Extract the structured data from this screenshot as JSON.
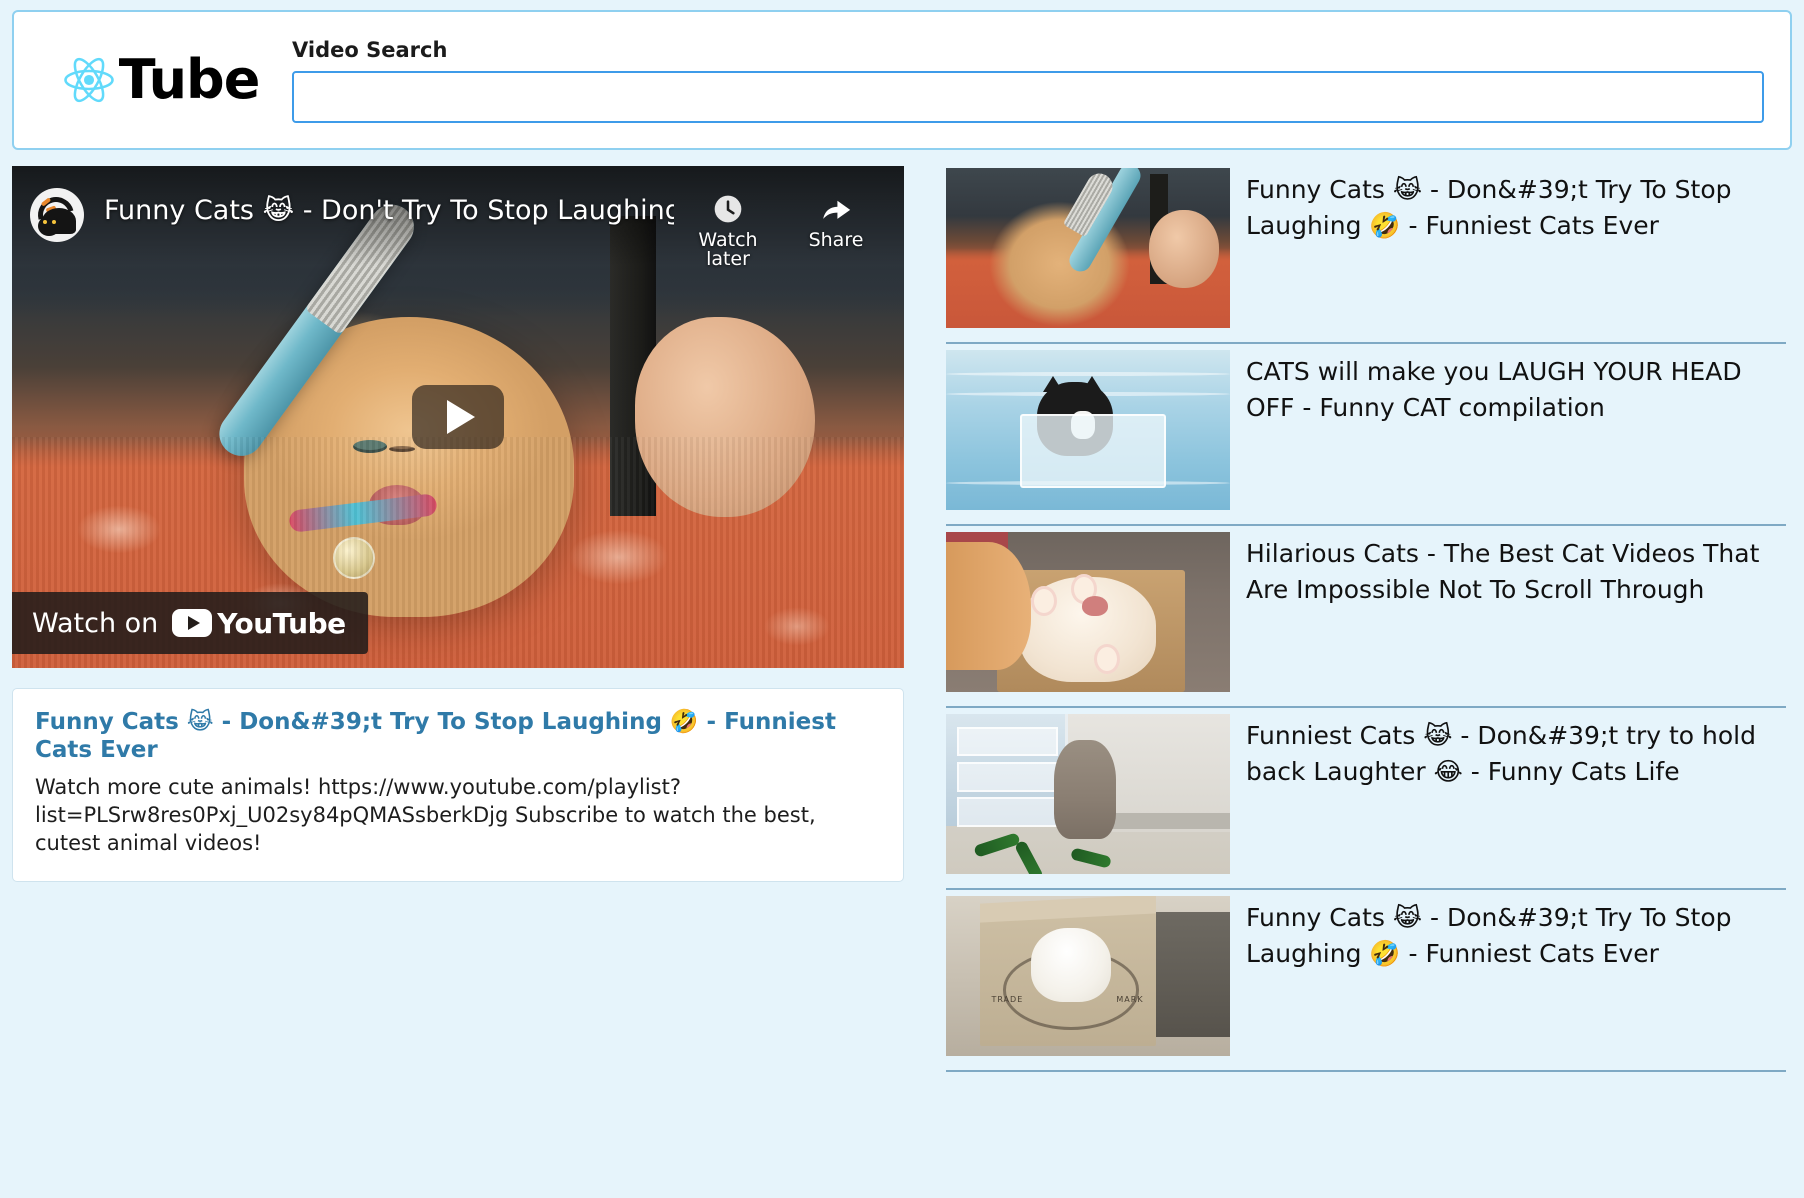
{
  "header": {
    "brand_name": "Tube",
    "logo_icon": "react-atom-icon",
    "logo_color": "#61dafb",
    "search_label": "Video Search",
    "search_value": "",
    "search_placeholder": ""
  },
  "player": {
    "overlay_title": "Funny Cats 😹 - Don't Try To Stop Laughing 🤣 - Fu…",
    "channel_avatar_icon": "black-cat-avatar-icon",
    "play_button_icon": "play-icon",
    "actions": [
      {
        "label": "Watch later",
        "icon": "clock-icon"
      },
      {
        "label": "Share",
        "icon": "share-arrow-icon"
      }
    ],
    "watch_on_text": "Watch on",
    "watch_on_brand": "YouTube",
    "watch_on_icon": "youtube-play-icon"
  },
  "description": {
    "title": "Funny Cats 😹 - Don&#39;t Try To Stop Laughing 🤣 - Funniest Cats Ever",
    "title_color": "#2f7aa8",
    "body": "Watch more cute animals! https://www.youtube.com/playlist?list=PLSrw8res0Pxj_U02sy84pQMASsberkDjg Subscribe to watch the best, cutest animal videos!"
  },
  "sidebar": {
    "items": [
      {
        "title": "Funny Cats 😹 - Don&#39;t Try To Stop Laughing 🤣 - Funniest Cats Ever",
        "thumbnail": "orange-cat-being-brushed"
      },
      {
        "title": "CATS will make you LAUGH YOUR HEAD OFF - Funny CAT compilation",
        "thumbnail": "tuxedo-cat-in-floating-box-pool"
      },
      {
        "title": "Hilarious Cats - The Best Cat Videos That Are Impossible Not To Scroll Through",
        "thumbnail": "white-orange-cat-lying-in-box"
      },
      {
        "title": "Funniest Cats 😹 - Don&#39;t try to hold back Laughter 😂 - Funny Cats Life",
        "thumbnail": "tabby-cat-with-cucumbers-by-fridge"
      },
      {
        "title": "Funny Cats 😹 - Don&#39;t Try To Stop Laughing 🤣 - Funniest Cats Ever",
        "thumbnail": "white-cat-head-through-cardboard-box"
      }
    ]
  },
  "theme": {
    "page_background": "#e6f4fb",
    "header_border": "#8fd0f0",
    "input_border": "#3d9be9",
    "divider": "#7fa9c4"
  }
}
